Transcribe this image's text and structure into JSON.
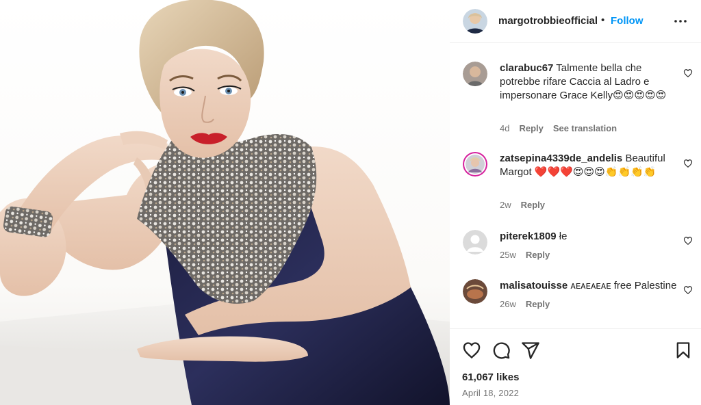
{
  "post": {
    "author": "margotrobbieofficial",
    "separator": "•",
    "follow_label": "Follow",
    "more_icon": "more-horizontal-icon"
  },
  "comments": [
    {
      "user": "clarabuc67",
      "text": "Talmente bella che potrebbe rifare Caccia al Ladro e impersonare Grace Kelly😍😍😍😍😍",
      "age": "4d",
      "reply_label": "Reply",
      "translate_label": "See translation"
    },
    {
      "user": "zatsepina4339de_andelis",
      "text": "Beautiful Margot ❤️❤️❤️😍😍😍👏👏👏👏",
      "age": "2w",
      "reply_label": "Reply"
    },
    {
      "user": "piterek1809",
      "text": "łe",
      "age": "25w",
      "reply_label": "Reply"
    },
    {
      "user": "malisatouisse",
      "text": "ᴀᴇᴀᴇᴀᴇᴀᴇ free Palestine",
      "age": "26w",
      "reply_label": "Reply"
    }
  ],
  "likes": "61,067 likes",
  "date": "April 18, 2022",
  "colors": {
    "accent": "#0095f6",
    "text": "#262626",
    "muted": "#737373",
    "divider": "#efefef",
    "story_ring": "#d6249f"
  }
}
